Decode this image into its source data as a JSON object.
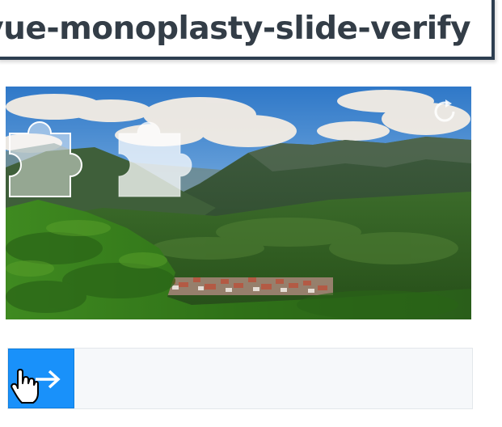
{
  "title": "vue-monoplasty-slide-verify",
  "verify": {
    "image_icon": "landscape-puzzle-image",
    "refresh_icon": "refresh-icon",
    "slider_icon": "arrow-right-icon",
    "cursor_icon": "hand-cursor-icon"
  },
  "colors": {
    "title_border": "#2d3e50",
    "title_text": "#333d47",
    "slider_handle": "#1991fa",
    "slider_track": "#f6f8fa"
  }
}
